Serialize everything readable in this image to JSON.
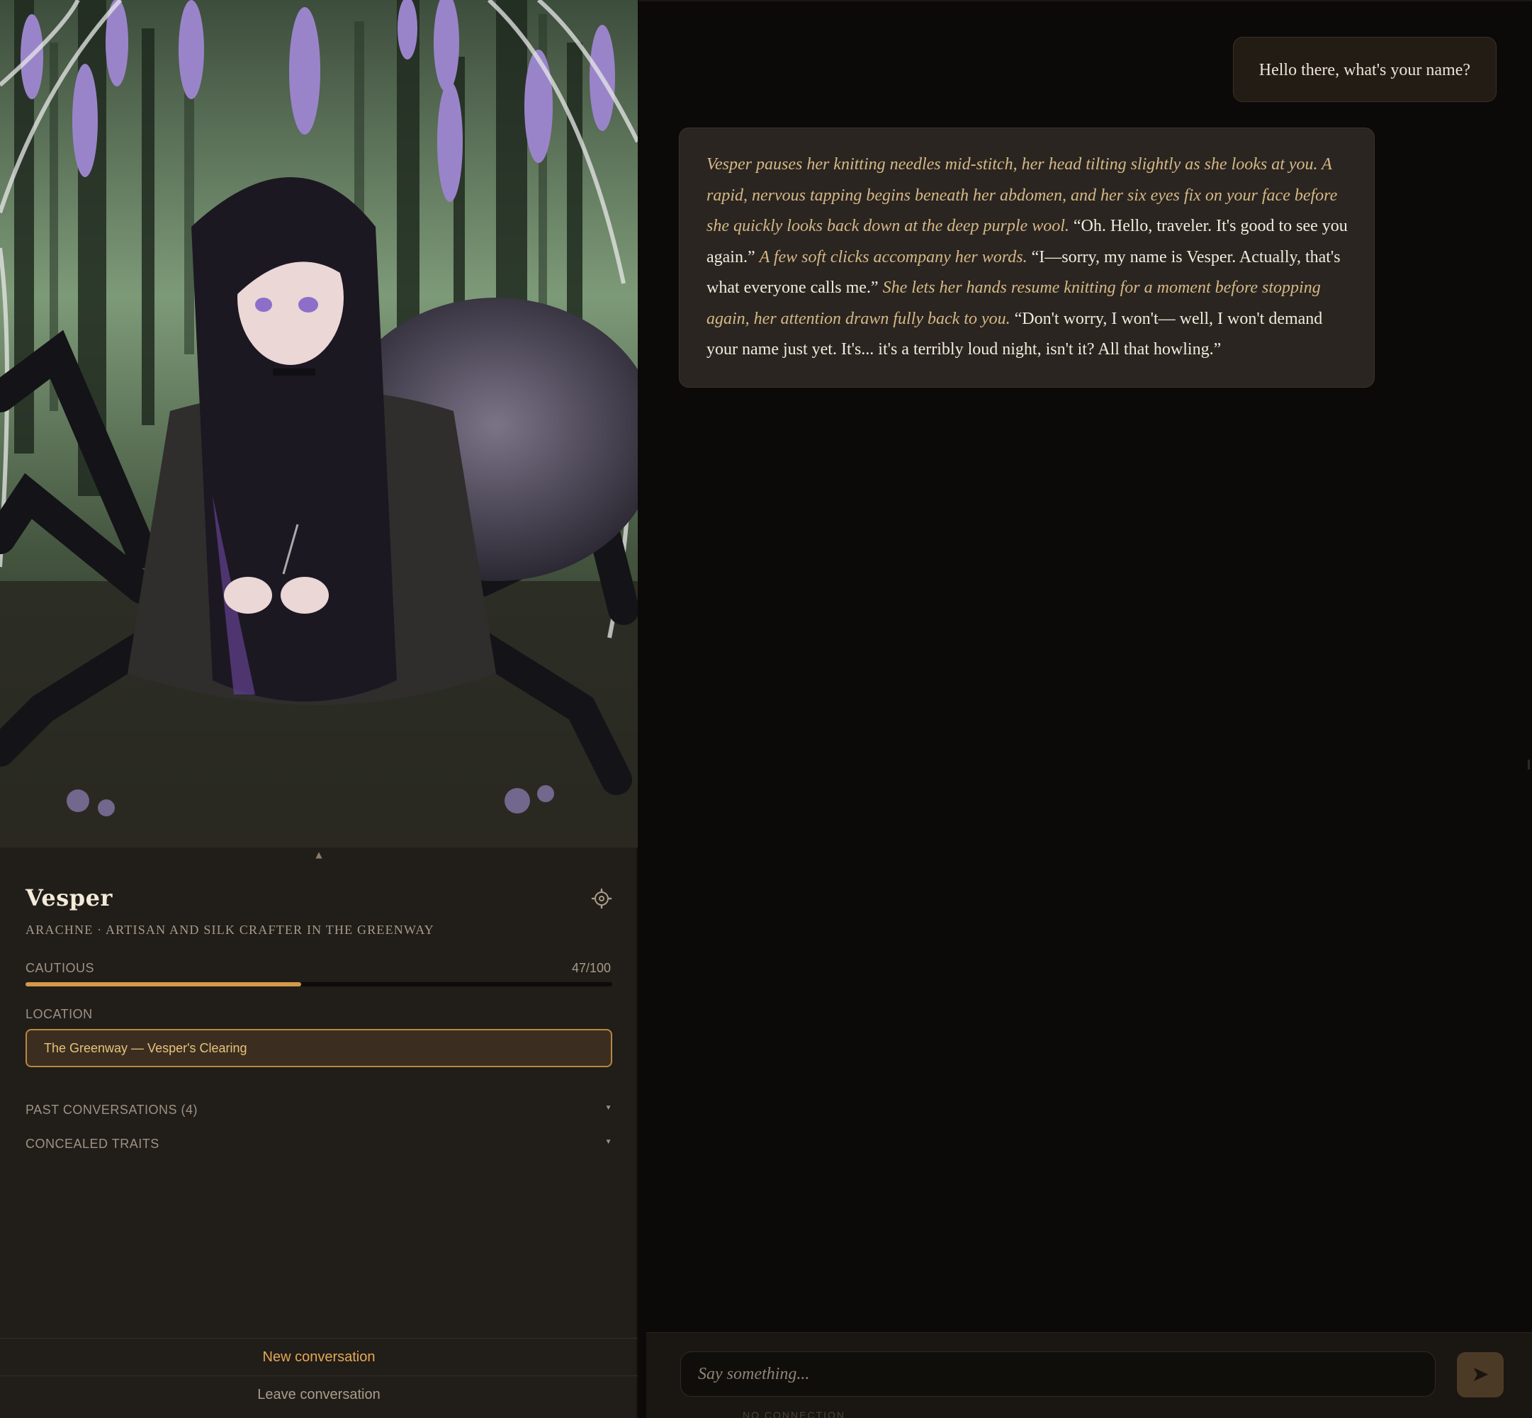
{
  "character": {
    "name": "Vesper",
    "subtitle": "ARACHNE · ARTISAN AND SILK CRAFTER IN THE GREENWAY",
    "portrait_icon": "character-portrait-image"
  },
  "mood": {
    "label": "CAUTIOUS",
    "value_text": "47/100",
    "value": 47,
    "max": 100,
    "bar_color": "#d49a48"
  },
  "location": {
    "label": "LOCATION",
    "value": "The Greenway — Vesper's Clearing"
  },
  "sections": {
    "past_conversations": "PAST CONVERSATIONS (4)",
    "concealed_traits": "CONCEALED TRAITS"
  },
  "actions": {
    "new_conversation": "New conversation",
    "leave_conversation": "Leave conversation"
  },
  "chat": {
    "user_message": "Hello there, what's your name?",
    "bot_message": [
      {
        "type": "action",
        "text": "Vesper pauses her knitting needles mid-stitch, her head tilting slightly as she looks at you. A rapid, nervous tapping begins beneath her abdomen, and her six eyes fix on your face before she quickly looks back down at the deep purple wool."
      },
      {
        "type": "speech",
        "text": " “Oh. Hello, traveler. It's good to see you again.” "
      },
      {
        "type": "action",
        "text": "A few soft clicks accompany her words."
      },
      {
        "type": "speech",
        "text": " “I—sorry, my name is Vesper. Actually, that's what everyone calls me.” "
      },
      {
        "type": "action",
        "text": "She lets her hands resume knitting for a moment before stopping again, her attention drawn fully back to you."
      },
      {
        "type": "speech",
        "text": " “Don't worry, I won't— well, I won't demand your name just yet. It's... it's a terribly loud night, isn't it? All that howling.”"
      }
    ]
  },
  "composer": {
    "placeholder": "Say something...",
    "send_icon": "send-arrow-icon",
    "status": "NO CONNECTION"
  },
  "colors": {
    "accent": "#e3a953",
    "panel": "#211d19",
    "chat_bg": "#0c0a08"
  }
}
